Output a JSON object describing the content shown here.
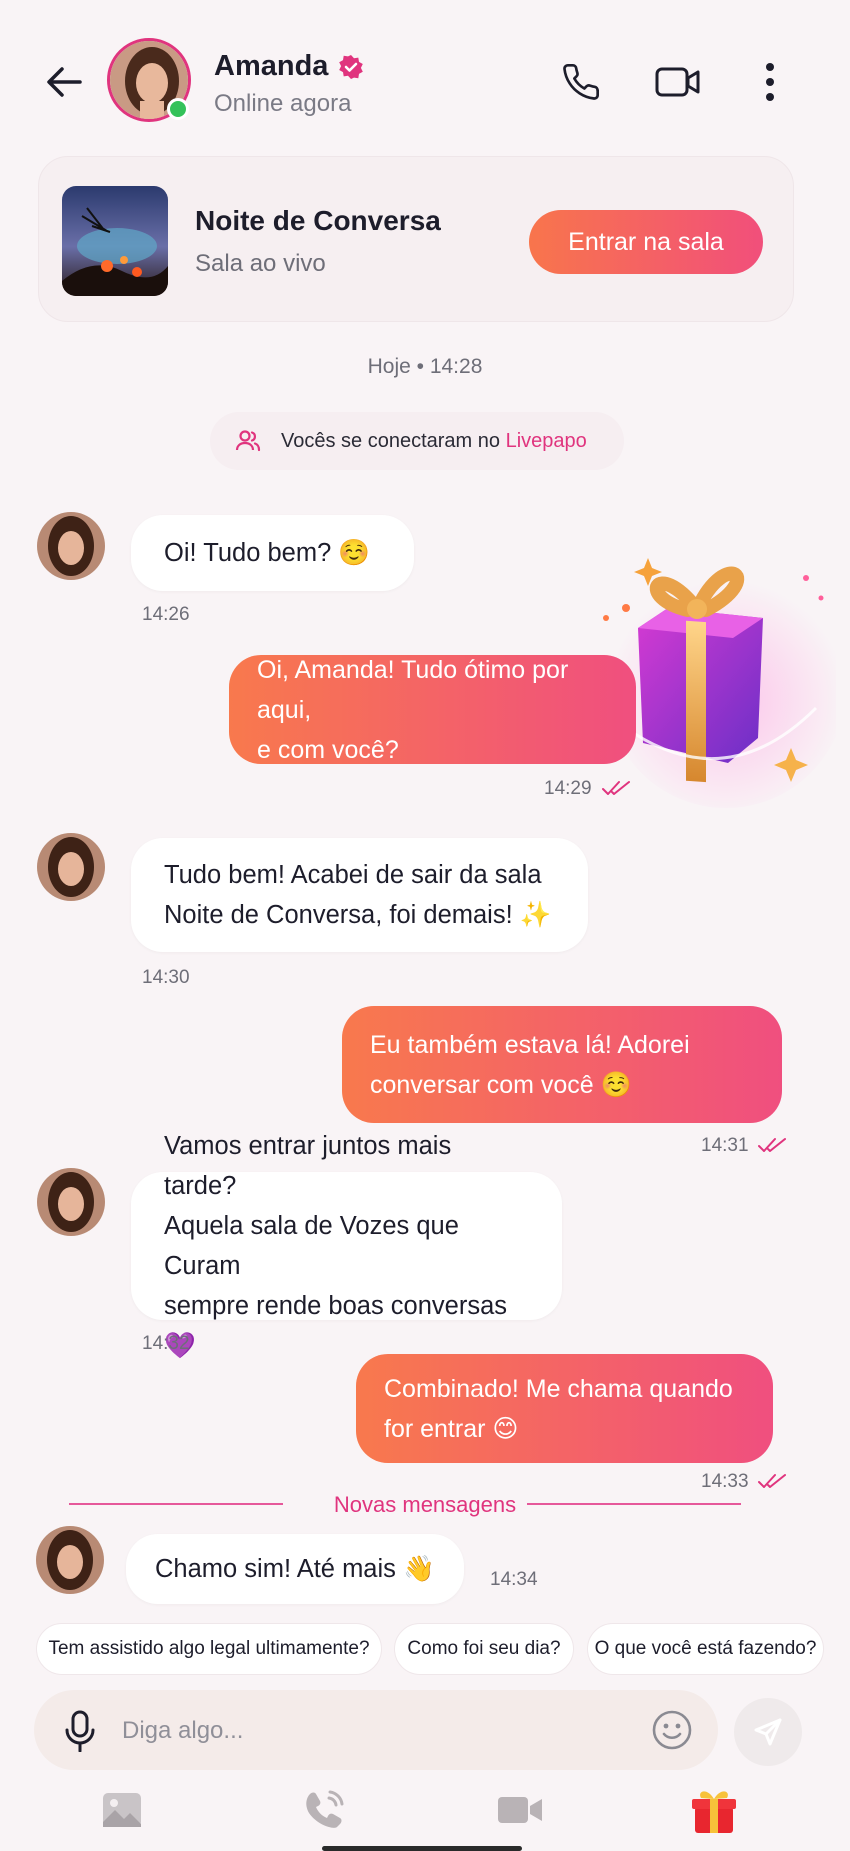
{
  "header": {
    "name": "Amanda",
    "status": "Online agora",
    "icons": [
      "back-arrow-icon",
      "phone-icon",
      "video-camera-icon",
      "more-vertical-icon",
      "verified-badge-icon"
    ]
  },
  "room_card": {
    "title": "Noite de Conversa",
    "subtitle": "Sala ao vivo",
    "button_label": "Entrar na sala"
  },
  "date_separator": "Hoje • 14:28",
  "connection_notice": {
    "text": "Vocês se conectaram no ",
    "brand": "Livepapo"
  },
  "messages": [
    {
      "direction": "in",
      "text": "Oi! Tudo bem? ☺️",
      "time": "14:26"
    },
    {
      "direction": "out",
      "lines": [
        "Oi, Amanda! Tudo ótimo por aqui,",
        "e com você?"
      ],
      "time": "14:29",
      "read": true
    },
    {
      "direction": "in",
      "lines": [
        "Tudo bem! Acabei de sair da sala",
        "Noite de Conversa, foi demais! ✨"
      ],
      "time": "14:30"
    },
    {
      "direction": "out",
      "lines": [
        "Eu também estava lá! Adorei",
        "conversar com você ☺️"
      ],
      "time": "14:31",
      "read": true
    },
    {
      "direction": "in",
      "lines": [
        "Vamos entrar juntos mais tarde?",
        "Aquela sala de Vozes que Curam",
        "sempre rende boas conversas 💜"
      ],
      "time": "14:32"
    },
    {
      "direction": "out",
      "lines": [
        "Combinado! Me chama quando",
        "for entrar 😊"
      ],
      "time": "14:33",
      "read": true
    },
    {
      "direction": "in",
      "text": "Chamo sim! Até mais 👋",
      "time": "14:34"
    }
  ],
  "new_messages_label": "Novas mensagens",
  "suggestions": [
    "Tem assistido algo legal ultimamente?",
    "Como foi seu dia?",
    "O que você está fazendo?"
  ],
  "composer": {
    "placeholder": "Diga algo..."
  },
  "bottom_bar": [
    "gallery-icon",
    "voice-call-icon",
    "video-icon",
    "gift-icon"
  ],
  "colors": {
    "accent": "#e0347e",
    "gradient_start": "#f8754c",
    "gradient_end": "#f14f7b",
    "online": "#34c25a",
    "background": "#f9f4f6"
  }
}
